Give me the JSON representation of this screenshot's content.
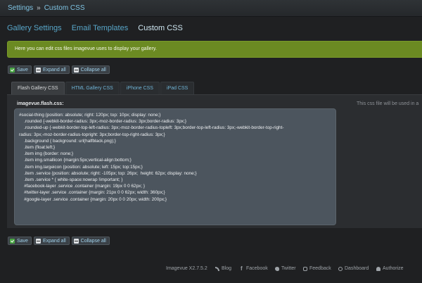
{
  "breadcrumb": {
    "root": "Settings",
    "separator": "»",
    "current": "Custom CSS"
  },
  "tabs": [
    {
      "label": "Gallery Settings",
      "active": false
    },
    {
      "label": "Email Templates",
      "active": false
    },
    {
      "label": "Custom CSS",
      "active": true
    }
  ],
  "notice": {
    "text": "Here you can edit css files imagevue uses to display your gallery.",
    "color": "#6b8a22"
  },
  "toolbar": {
    "save_label": "Save",
    "expand_label": "Expand all",
    "collapse_label": "Collapse all"
  },
  "css_tabs": [
    {
      "label": "Flash Gallery CSS",
      "active": true
    },
    {
      "label": "HTML Gallery CSS",
      "active": false
    },
    {
      "label": "iPhone CSS",
      "active": false
    },
    {
      "label": "iPad CSS",
      "active": false
    }
  ],
  "file": {
    "name": "imagevue.flash.css:",
    "help": "This css file will be used in a",
    "lines": [
      "#social-thing {position: absolute; right: 120px; top: 10px; display: none;}",
      "    .rounded {-webkit-border-radius: 3px;-moz-border-radius: 3px;border-radius: 3px;}",
      "    .rounded-up {-webkit-border-top-left-radius: 3px;-moz-border-radius-topleft: 3px;border-top-left-radius: 3px;-webkit-border-top-right-",
      "radius: 3px;-moz-border-radius-topright: 3px;border-top-right-radius: 3px;}",
      "    .background { background: url(halfblack.png);}",
      "    .item {float:left;}",
      "    .item img {border: none;}",
      "    .item img.smallicon {margin:5px;vertical-align:bottom;}",
      "    .item img.largeicon {position: absolute; left: 15px; top:15px;}",
      "    .item .service {position: absolute; right: -105px; top: 26px;  height: 62px; display: none;}",
      "    .item .service * { white-space:nowrap !important; }",
      "    #facebook-layer .service .container {margin: 19px 0 0 62px; }",
      "    #twitter-layer .service .container {margin: 21px 0 0 62px; width: 360px;}",
      "    #google-layer .service .container {margin: 20px 0 0 20px; width: 200px;}"
    ]
  },
  "footer": {
    "version": "Imagevue X2.7.5.2",
    "links": [
      {
        "label": "Blog",
        "icon": "rss-icon"
      },
      {
        "label": "Facebook",
        "icon": "facebook-icon"
      },
      {
        "label": "Twitter",
        "icon": "twitter-icon"
      },
      {
        "label": "Feedback",
        "icon": "feedback-icon"
      },
      {
        "label": "Dashboard",
        "icon": "dashboard-icon"
      },
      {
        "label": "Authorize",
        "icon": "user-icon"
      }
    ]
  }
}
